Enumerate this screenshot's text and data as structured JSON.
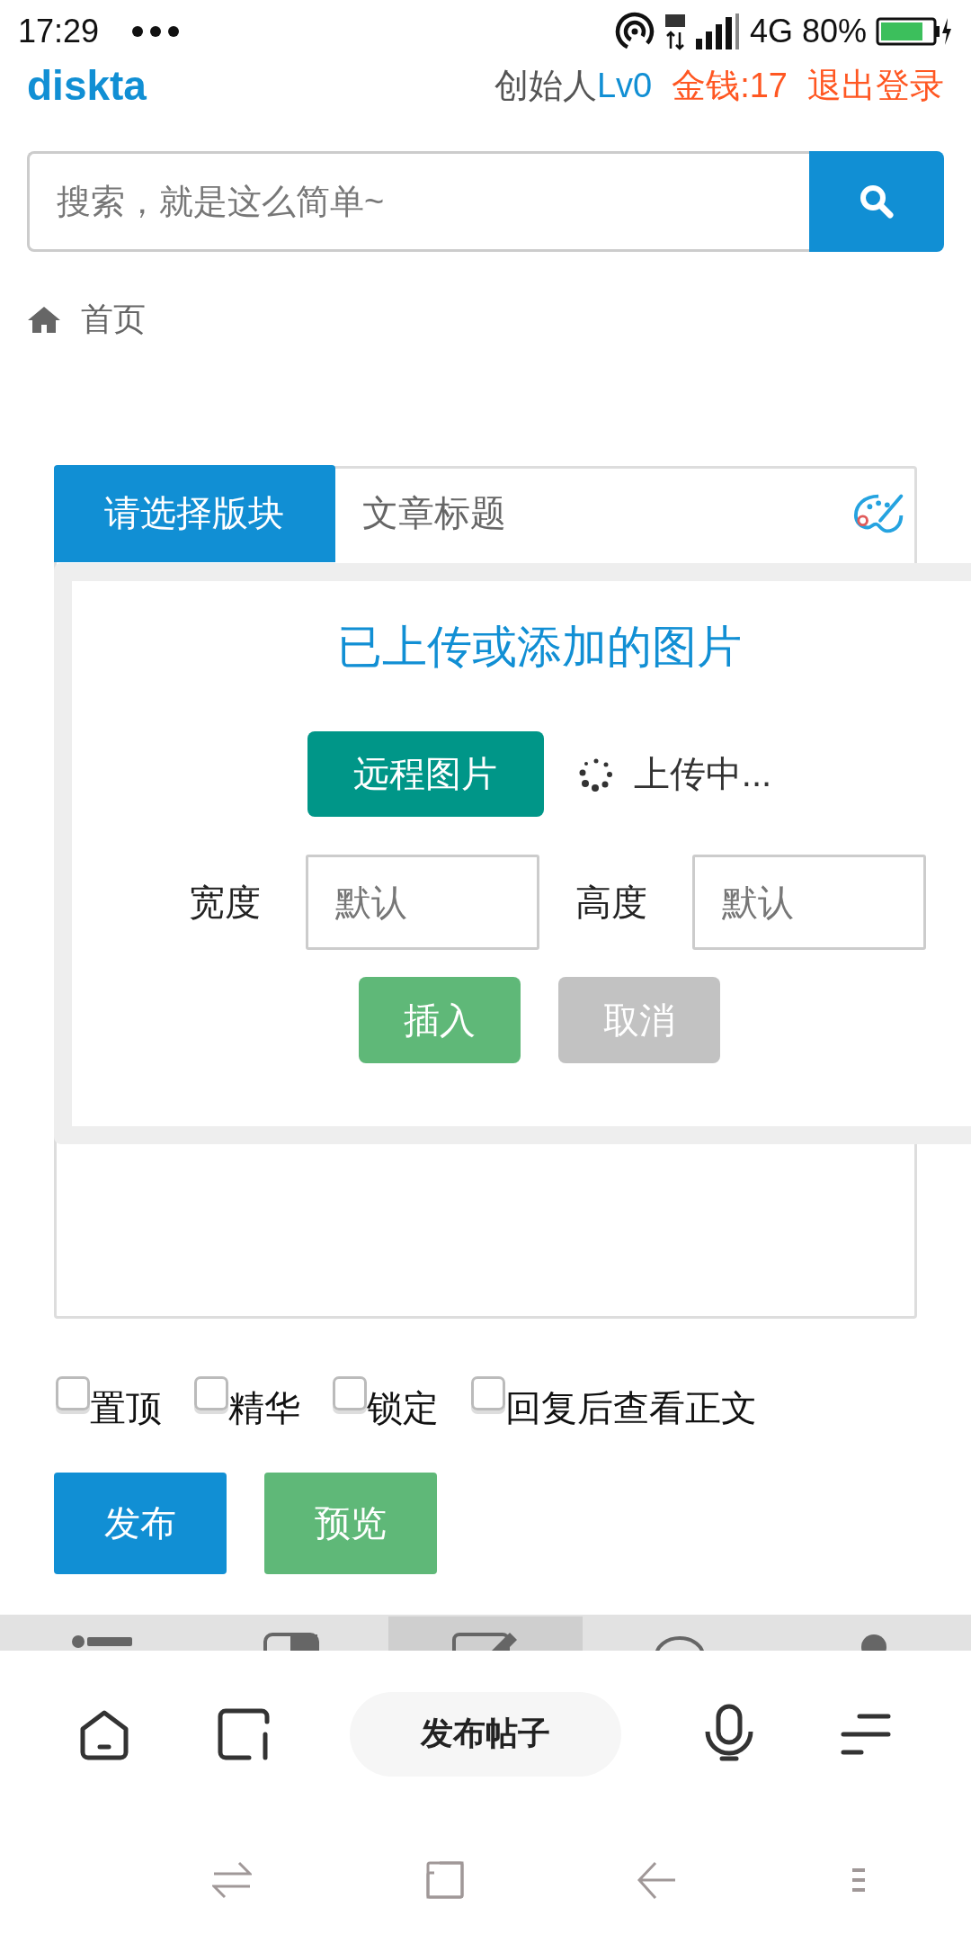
{
  "status_bar": {
    "time": "17:29",
    "network": "4G",
    "battery": "80%"
  },
  "header": {
    "logo": "diskta",
    "user_title": "创始人",
    "level": "Lv0",
    "money": "金钱:17",
    "logout": "退出登录"
  },
  "search": {
    "placeholder": "搜索，就是这么简单~"
  },
  "breadcrumb": [
    "首页"
  ],
  "editor": {
    "category_tab": "请选择版块",
    "title_placeholder": "文章标题"
  },
  "image_dialog": {
    "title": "已上传或添加的图片",
    "remote_button": "远程图片",
    "upload_status": "上传中...",
    "fields": [
      {
        "label": "宽度",
        "placeholder": "默认"
      },
      {
        "label": "高度",
        "placeholder": "默认"
      }
    ],
    "buttons": [
      {
        "label": "插入",
        "kind": "primary"
      },
      {
        "label": "取消",
        "kind": "cancel"
      }
    ]
  },
  "options": [
    {
      "label": "置顶",
      "checked": false
    },
    {
      "label": "精华",
      "checked": false
    },
    {
      "label": "锁定",
      "checked": false
    },
    {
      "label": "回复后查看正文",
      "checked": false
    }
  ],
  "actions": [
    {
      "label": "发布",
      "kind": "submit"
    },
    {
      "label": "预览",
      "kind": "preview"
    }
  ],
  "site_tabbar": [
    {
      "kind": "list",
      "selected": false
    },
    {
      "kind": "card",
      "selected": false
    },
    {
      "kind": "edit",
      "selected": true
    },
    {
      "kind": "chat",
      "selected": false
    },
    {
      "kind": "user",
      "selected": false
    }
  ],
  "browser_toolbar": {
    "title": "发布帖子"
  }
}
